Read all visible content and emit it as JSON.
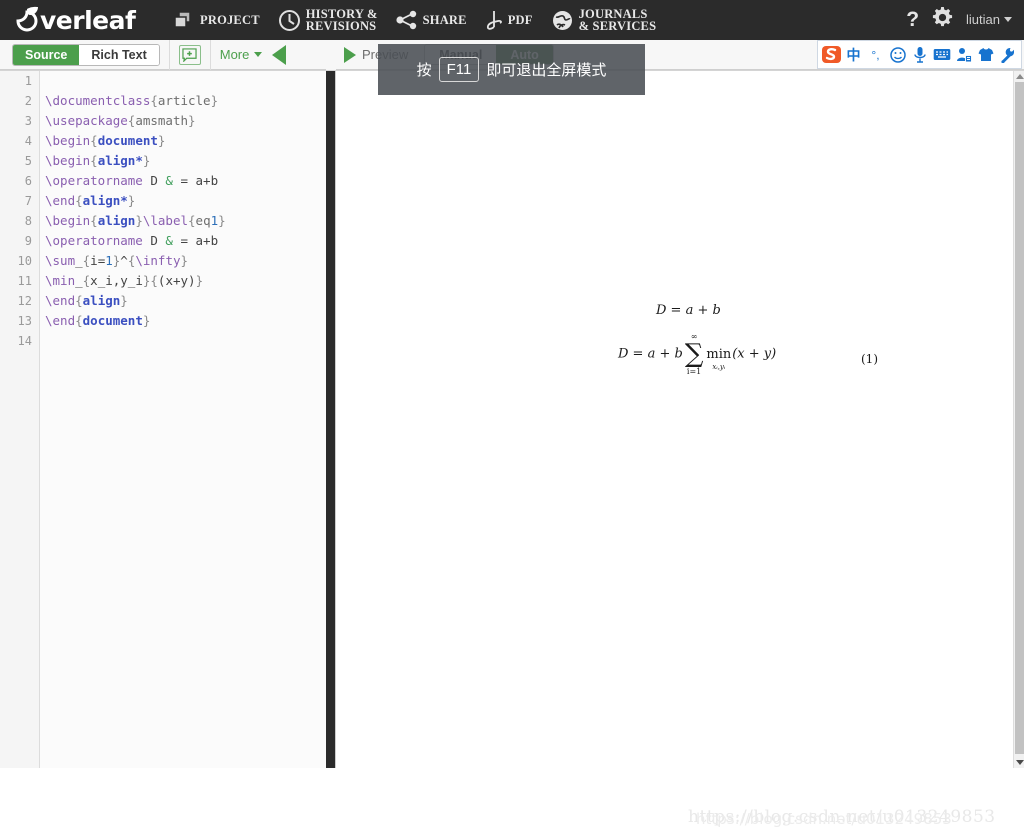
{
  "topnav": {
    "brand": "verleaf",
    "items": [
      {
        "label": "PROJECT",
        "icon": "windows-stack-icon"
      },
      {
        "label": "HISTORY &\n REVISIONS",
        "icon": "clock-icon"
      },
      {
        "label": "SHARE",
        "icon": "share-nodes-icon"
      },
      {
        "label": "PDF",
        "icon": "pdf-icon"
      },
      {
        "label": "JOURNALS\n& SERVICES",
        "icon": "globe-icon"
      }
    ],
    "help": "?",
    "settings_icon": "gear-icon",
    "user": "liutian"
  },
  "toolbar": {
    "source_label": "Source",
    "richtext_label": "Rich Text",
    "comment_icon": "comment-plus-icon",
    "more_label": "More",
    "collapse_icon": "triangle-left-icon",
    "preview_label": "Preview",
    "preview_icon": "play-triangle-icon",
    "manual_label": "Manual",
    "auto_label": "Auto",
    "active_mode": "Source",
    "active_compile": "Auto"
  },
  "ime": {
    "logo": "sogou-logo-icon",
    "items": [
      {
        "icon": "chinese-mode-icon",
        "glyph": "中"
      },
      {
        "icon": "punctuation-icon",
        "glyph": "°,"
      },
      {
        "icon": "emoji-icon",
        "glyph": "☺"
      },
      {
        "icon": "microphone-icon",
        "glyph": "🎤"
      },
      {
        "icon": "keyboard-icon",
        "glyph": "⌨"
      },
      {
        "icon": "user-card-icon",
        "glyph": "👤"
      },
      {
        "icon": "skin-shirt-icon",
        "glyph": "👕"
      },
      {
        "icon": "wrench-icon",
        "glyph": "🔧"
      }
    ]
  },
  "editor": {
    "line_numbers": [
      "1",
      "2",
      "3",
      "4",
      "5",
      "6",
      "7",
      "8",
      "9",
      "10",
      "11",
      "12",
      "13",
      "14"
    ],
    "lines": [
      "",
      "\\documentclass{article}",
      "\\usepackage{amsmath}",
      "\\begin{document}",
      "\\begin{align*}",
      "\\operatorname D & = a+b",
      "\\end{align*}",
      "\\begin{align}\\label{eq1}",
      "\\operatorname D & = a+b",
      "\\sum_{i=1}^{\\infty}",
      "\\min_{x_i,y_i}{(x+y)}",
      "\\end{align}",
      "\\end{document}",
      ""
    ]
  },
  "tooltip": {
    "prefix": "按",
    "key": "F11",
    "suffix": "即可退出全屏模式"
  },
  "preview": {
    "equation1": "D = a + b",
    "equation2_lhs": "D = a + b",
    "sum_upper": "∞",
    "sum_lower": "i=1",
    "min_label": "min",
    "min_sub": "xᵢ,yᵢ",
    "equation2_rhs": "(x + y)",
    "equation_number": "(1)",
    "watermark": "https://blog.csdn.net/u013249853"
  },
  "colors": {
    "navbar": "#2b2b2b",
    "accent_green": "#4c9f4c",
    "compile_green": "#4c7f46",
    "ime_blue": "#1773cf",
    "tooltip_bg": "rgba(74,79,84,0.88)"
  }
}
